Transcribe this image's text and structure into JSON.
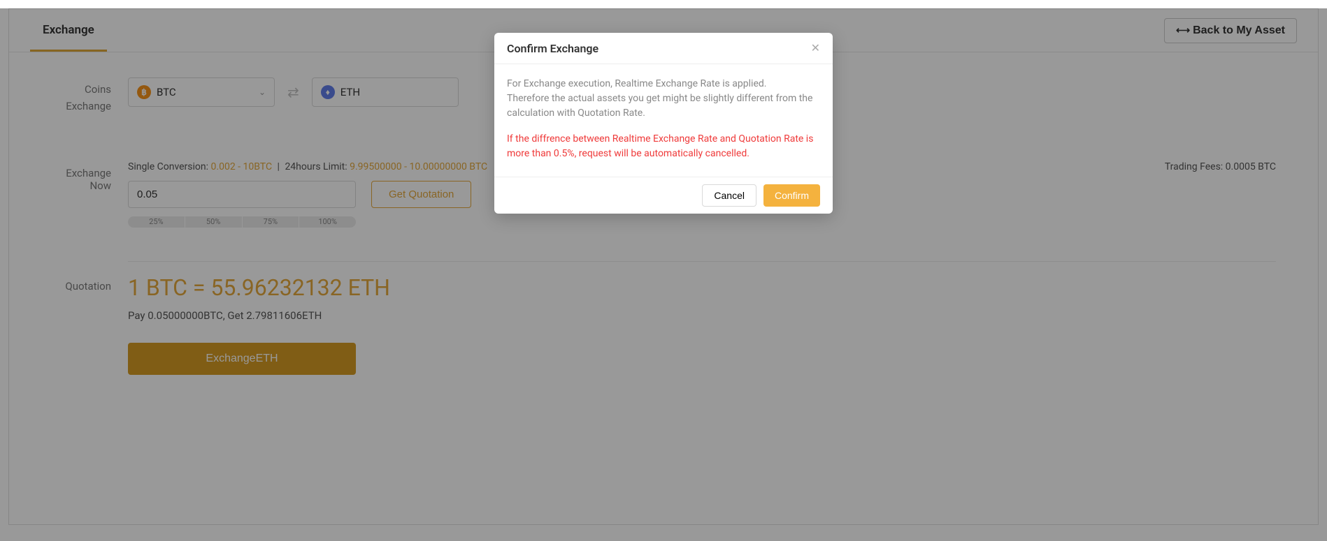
{
  "header": {
    "tab_label": "Exchange",
    "back_label": "Back to My Asset"
  },
  "coins": {
    "label": "Coins",
    "sub_label": "Exchange",
    "from_symbol": "BTC",
    "to_symbol": "ETH"
  },
  "exchange_now": {
    "label": "Exchange Now",
    "single_conv_label": "Single Conversion:",
    "single_conv_value": "0.002 - 10BTC",
    "hours_limit_label": "24hours Limit:",
    "hours_limit_value": "9.99500000 - 10.00000000 BTC",
    "trading_fees_label": "Trading Fees:",
    "trading_fees_value": "0.0005 BTC",
    "amount_value": "0.05",
    "get_quotation_label": "Get Quotation",
    "percents": [
      "25%",
      "50%",
      "75%",
      "100%"
    ]
  },
  "quotation": {
    "label": "Quotation",
    "rate_text": "1 BTC = 55.96232132 ETH",
    "pay_get_text": "Pay 0.05000000BTC,   Get 2.79811606ETH",
    "exchange_button": "ExchangeETH"
  },
  "modal": {
    "title": "Confirm Exchange",
    "body_line1": "For Exchange execution, Realtime Exchange Rate is applied.",
    "body_line2": "Therefore the actual assets you get might be slightly different from the calculation with Quotation Rate.",
    "warn_text": "If the diffrence between Realtime Exchange Rate and Quotation Rate is more than 0.5%, request will be automatically cancelled.",
    "cancel_label": "Cancel",
    "confirm_label": "Confirm"
  }
}
